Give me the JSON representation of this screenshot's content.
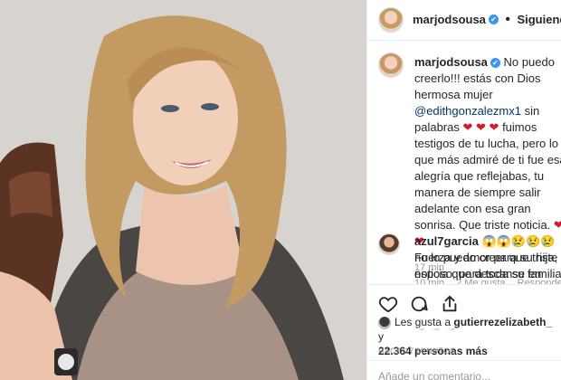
{
  "post": {
    "username": "marjodsousa",
    "verified_mark": "✔",
    "separator": "•",
    "follow_status": "Siguiendo"
  },
  "caption": {
    "username": "marjodsousa",
    "text_1": "No puedo creerlo!!! estás con Dios hermosa mujer",
    "mention": "@edithgonzalezmx1",
    "text_2": "sin palabras",
    "hearts_1": "❤",
    "hearts_2": "❤ ❤",
    "text_3": "fuimos testigos de tu lucha, pero lo que más admiré de ti fue esa alegría que reflejabas, tu manera de siempre salir adelante con esa gran sonrisa. Que triste noticia.",
    "hearts_3": "❤ ❤",
    "text_4": "Fuerza y amor para su hija, esposo, para toda su familia. Vuela alto rubia hermosa.",
    "claps": "👏🏻 👏🏻 👏🏻 👏🏻 👏🏻 👏🏻 👏🏻 👏🏻 👏🏻 👏🏻 👏🏻 👏🏻 👏🏻 👏🏻",
    "time": "17 min"
  },
  "comment": {
    "username": "azul7garcia",
    "emojis": "😱😱😢😢😢",
    "text": "no lo puedo creer que triste noticia que descanse en paz",
    "time": "10 min",
    "likes": "2 Me gusta",
    "reply": "Responder"
  },
  "likes": {
    "prefix": "Les gusta a",
    "user": "gutierrezelizabeth_",
    "connector": "y",
    "count": "22.364 personas más"
  },
  "timestamp": "HACE 17 MINUTOS",
  "add_comment_placeholder": "Añade un comentario...",
  "icons": [
    "heart-icon",
    "comment-icon",
    "share-icon"
  ]
}
